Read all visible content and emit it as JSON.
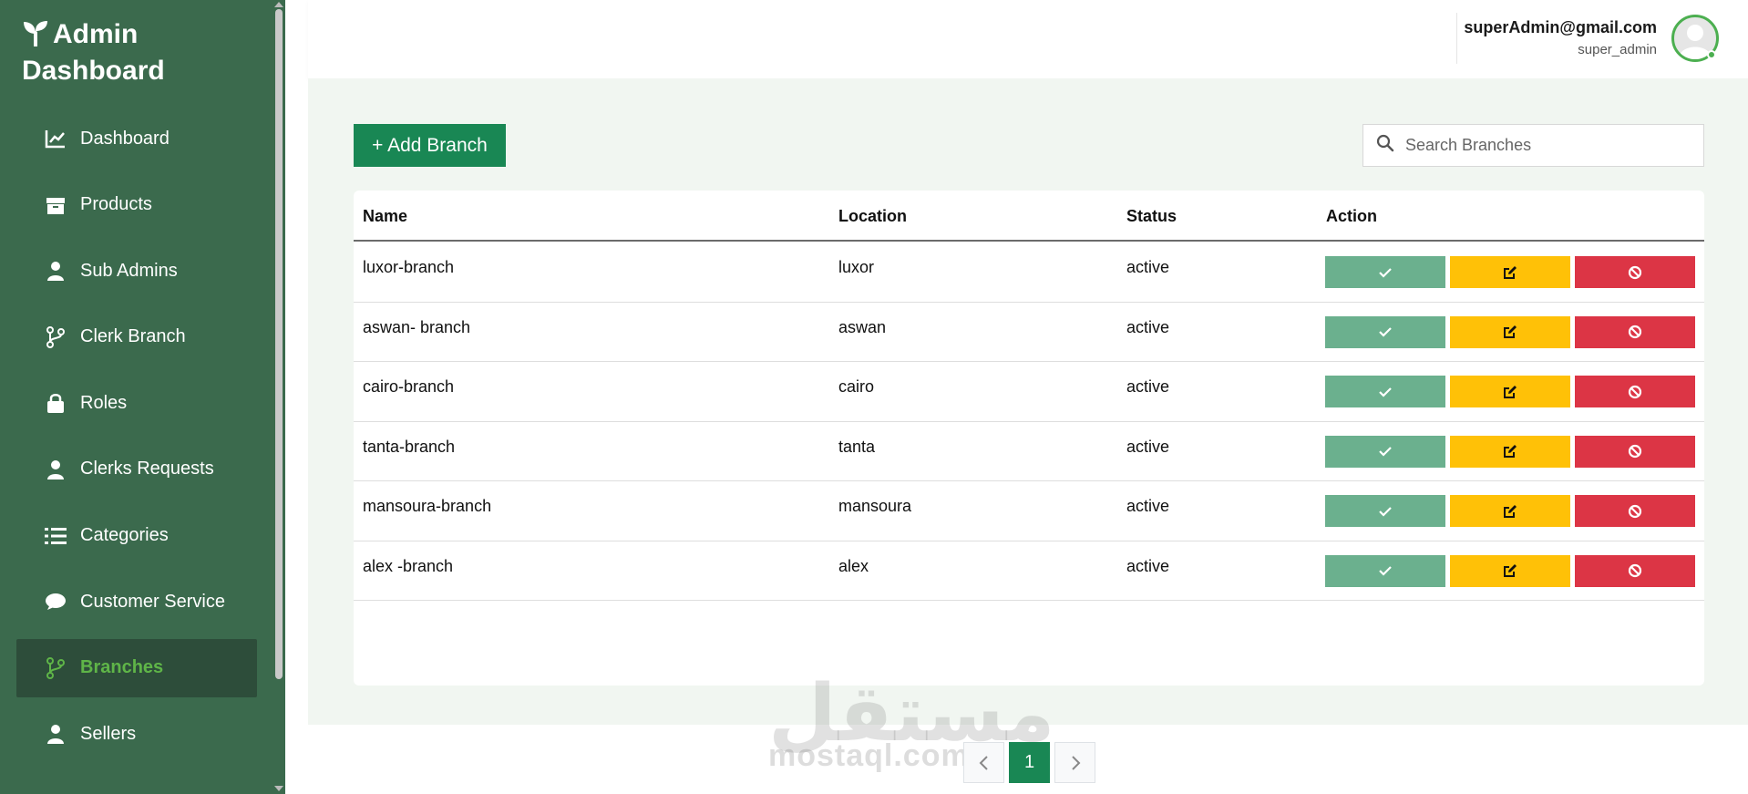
{
  "brand": {
    "line1": "Admin",
    "line2": "Dashboard"
  },
  "sidebar": {
    "items": [
      {
        "label": "Dashboard",
        "icon": "chart-line-icon"
      },
      {
        "label": "Products",
        "icon": "box-icon"
      },
      {
        "label": "Sub Admins",
        "icon": "user-icon"
      },
      {
        "label": "Clerk Branch",
        "icon": "code-branch-icon"
      },
      {
        "label": "Roles",
        "icon": "lock-icon"
      },
      {
        "label": "Clerks Requests",
        "icon": "user-icon"
      },
      {
        "label": "Categories",
        "icon": "list-icon"
      },
      {
        "label": "Customer Service",
        "icon": "comment-icon"
      },
      {
        "label": "Branches",
        "icon": "code-branch-icon",
        "active": true
      },
      {
        "label": "Sellers",
        "icon": "user-icon"
      }
    ]
  },
  "header": {
    "email": "superAdmin@gmail.com",
    "role": "super_admin"
  },
  "toolbar": {
    "add_label": "+ Add Branch",
    "search_placeholder": "Search Branches"
  },
  "table": {
    "headers": {
      "name": "Name",
      "location": "Location",
      "status": "Status",
      "action": "Action"
    },
    "rows": [
      {
        "name": "luxor-branch",
        "location": "luxor",
        "status": "active"
      },
      {
        "name": "aswan- branch",
        "location": "aswan",
        "status": "active"
      },
      {
        "name": "cairo-branch",
        "location": "cairo",
        "status": "active"
      },
      {
        "name": "tanta-branch",
        "location": "tanta",
        "status": "active"
      },
      {
        "name": "mansoura-branch",
        "location": "mansoura",
        "status": "active"
      },
      {
        "name": "alex -branch",
        "location": "alex",
        "status": "active"
      }
    ]
  },
  "pagination": {
    "current": "1"
  },
  "watermark": {
    "arabic": "مستقل",
    "latin": "mostaql.com"
  },
  "colors": {
    "sidebar": "#3b6a4d",
    "active_text": "#5fb548",
    "primary": "#198754",
    "approve": "#6bb08e",
    "edit": "#ffc107",
    "block": "#dc3545"
  }
}
